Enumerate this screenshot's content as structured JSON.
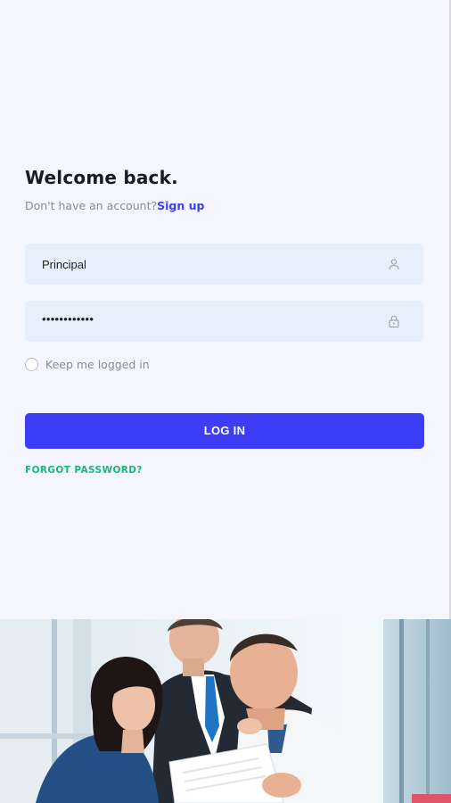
{
  "login": {
    "title": "Welcome back.",
    "no_account_text": "Don't have an account?",
    "signup_label": "Sign up",
    "username_value": "Principal",
    "password_value": "••••••••••••",
    "keep_logged_in_label": "Keep me logged in",
    "keep_logged_in_checked": false,
    "login_button_label": "LOG IN",
    "forgot_password_label": "FORGOT PASSWORD?"
  },
  "icons": {
    "username": "user-icon",
    "password": "lock-icon"
  },
  "colors": {
    "background": "#f5f5fd",
    "field_background": "#e6effc",
    "primary": "#3d3df5",
    "link": "#3b3ff2",
    "forgot": "#18b87a",
    "title": "#1b1b22",
    "muted": "#8a8a96"
  }
}
